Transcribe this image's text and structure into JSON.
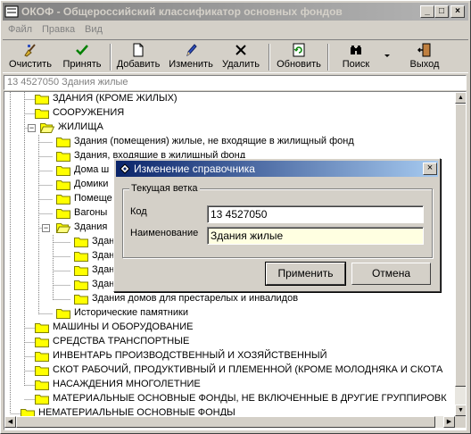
{
  "window": {
    "title": "ОКОФ - Общероссийский классификатор основных фондов",
    "controls": {
      "minimize": "_",
      "maximize": "□",
      "close": "×"
    }
  },
  "menu": [
    "Файл",
    "Правка",
    "Вид"
  ],
  "toolbar": {
    "clear": "Очистить",
    "accept": "Принять",
    "add": "Добавить",
    "edit": "Изменить",
    "delete": "Удалить",
    "refresh": "Обновить",
    "search": "Поиск",
    "exit": "Выход"
  },
  "path_text": "13 4527050 Здания жилые",
  "tree": {
    "items": [
      "ЗДАНИЯ (КРОМЕ ЖИЛЫХ)",
      "СООРУЖЕНИЯ",
      "ЖИЛИЩА",
      "Здания (помещения) жилые, не входящие в жилищный фонд",
      "Здания, входящие в жилищный фонд",
      "Дома ш",
      "Домики",
      "Помеще",
      "Вагоны",
      "Здания",
      "Здан",
      "Здан",
      "Здан",
      "Здан",
      "Здания домов для престарелых и инвалидов",
      "Исторические памятники",
      "МАШИНЫ И ОБОРУДОВАНИЕ",
      "СРЕДСТВА ТРАНСПОРТНЫЕ",
      "ИНВЕНТАРЬ ПРОИЗВОДСТВЕННЫЙ И ХОЗЯЙСТВЕННЫЙ",
      "СКОТ РАБОЧИЙ, ПРОДУКТИВНЫЙ И ПЛЕМЕННОЙ (КРОМЕ МОЛОДНЯКА И СКОТА",
      "НАСАЖДЕНИЯ МНОГОЛЕТНИЕ",
      "МАТЕРИАЛЬНЫЕ ОСНОВНЫЕ ФОНДЫ, НЕ ВКЛЮЧЕННЫЕ В ДРУГИЕ ГРУППИРОВК",
      "НЕМАТЕРИАЛЬНЫЕ ОСНОВНЫЕ ФОНДЫ"
    ],
    "expanders": [
      "−",
      "−"
    ]
  },
  "dialog": {
    "title": "Изменение справочника",
    "group_caption": "Текущая ветка",
    "code_label": "Код",
    "code_value": "13 4527050",
    "name_label": "Наименование",
    "name_value": "Здания жилые",
    "apply": "Применить",
    "cancel": "Отмена",
    "close": "×"
  },
  "colors": {
    "folder": "#ffff00",
    "dialog_title_start": "#0a246a",
    "dialog_title_end": "#a6caf0",
    "name_field_bg": "#ffffe1"
  }
}
